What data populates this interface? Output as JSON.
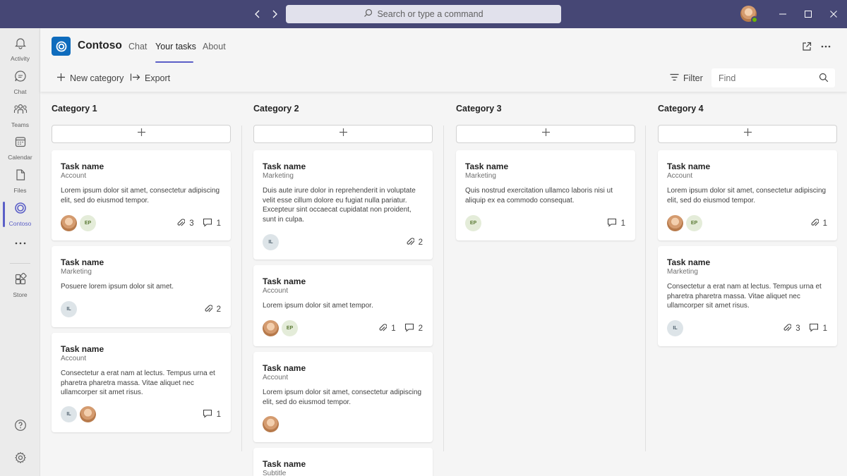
{
  "titlebar": {
    "search_placeholder": "Search or type a command",
    "icons": [
      "back-icon",
      "forward-icon",
      "search-icon",
      "minimize-icon",
      "maximize-icon",
      "close-icon"
    ]
  },
  "rail": {
    "items": [
      {
        "label": "Activity",
        "icon": "bell-icon"
      },
      {
        "label": "Chat",
        "icon": "chat-icon"
      },
      {
        "label": "Teams",
        "icon": "teams-icon"
      },
      {
        "label": "Calendar",
        "icon": "calendar-icon"
      },
      {
        "label": "Files",
        "icon": "file-icon"
      },
      {
        "label": "Contoso",
        "icon": "contoso-icon",
        "active": true
      },
      {
        "label": "Store",
        "icon": "store-icon"
      }
    ]
  },
  "app": {
    "name": "Contoso",
    "tabs": [
      {
        "label": "Chat"
      },
      {
        "label": "Your tasks",
        "active": true
      },
      {
        "label": "About"
      }
    ]
  },
  "toolbar": {
    "new_category": "New category",
    "export": "Export",
    "filter": "Filter",
    "find_placeholder": "Find"
  },
  "columns": [
    {
      "title": "Category 1",
      "cards": [
        {
          "title": "Task name",
          "subtitle": "Account",
          "desc": "Lorem ipsum dolor sit amet, consectetur adipiscing elit, sed do eiusmod tempor.",
          "people": [
            "photo",
            "EP"
          ],
          "attachments": "3",
          "comments": "1"
        },
        {
          "title": "Task name",
          "subtitle": "Marketing",
          "desc": "Posuere lorem ipsum dolor sit amet.",
          "people": [
            "IL"
          ],
          "attachments": "2"
        },
        {
          "title": "Task name",
          "subtitle": "Account",
          "desc": "Consectetur a erat nam at lectus. Tempus urna et pharetra pharetra massa. Vitae aliquet nec ullamcorper sit amet risus.",
          "people": [
            "IL",
            "photo"
          ],
          "comments": "1"
        }
      ]
    },
    {
      "title": "Category 2",
      "cards": [
        {
          "title": "Task name",
          "subtitle": "Marketing",
          "desc": "Duis aute irure dolor in reprehenderit in voluptate velit esse cillum dolore eu fugiat nulla pariatur. Excepteur sint occaecat cupidatat non proident, sunt in culpa.",
          "people": [
            "IL"
          ],
          "attachments": "2"
        },
        {
          "title": "Task name",
          "subtitle": "Account",
          "desc": "Lorem ipsum dolor sit amet tempor.",
          "people": [
            "photo",
            "EP"
          ],
          "attachments": "1",
          "comments": "2"
        },
        {
          "title": "Task name",
          "subtitle": "Account",
          "desc": "Lorem ipsum dolor sit amet, consectetur adipiscing elit, sed do eiusmod tempor.",
          "people": [
            "photo"
          ]
        },
        {
          "title": "Task name",
          "subtitle": "Subtitle"
        }
      ]
    },
    {
      "title": "Category 3",
      "cards": [
        {
          "title": "Task name",
          "subtitle": "Marketing",
          "desc": "Quis nostrud exercitation ullamco laboris nisi ut aliquip ex ea commodo consequat.",
          "people": [
            "EP"
          ],
          "comments": "1"
        }
      ]
    },
    {
      "title": "Category 4",
      "cards": [
        {
          "title": "Task name",
          "subtitle": "Account",
          "desc": "Lorem ipsum dolor sit amet, consectetur adipiscing elit, sed do eiusmod tempor.",
          "people": [
            "photo",
            "EP"
          ],
          "attachments": "1"
        },
        {
          "title": "Task name",
          "subtitle": "Marketing",
          "desc": "Consectetur a erat nam at lectus. Tempus urna et pharetra pharetra massa. Vitae aliquet nec ullamcorper sit amet risus.",
          "people": [
            "IL"
          ],
          "attachments": "3",
          "comments": "1"
        }
      ]
    }
  ],
  "colors": {
    "titlebar": "#464775",
    "accent": "#5b5fc7",
    "app_logo": "#0f6cbd",
    "presence": "#6bb700"
  }
}
